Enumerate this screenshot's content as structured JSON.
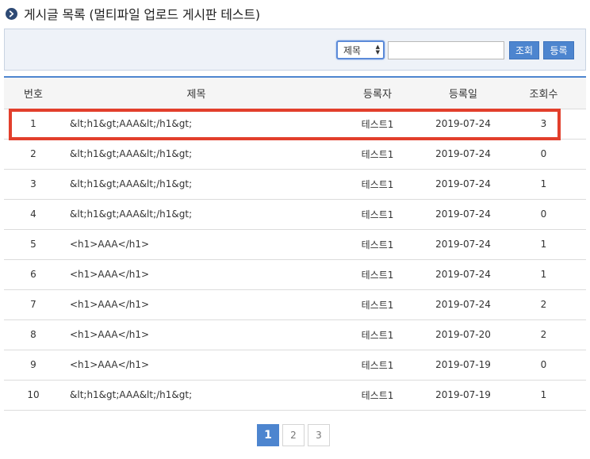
{
  "page": {
    "title": "게시글 목록 (멀티파일 업로드 게시판 테스트)",
    "title_icon": "chevron-right-circle-icon"
  },
  "search": {
    "select_value": "제목",
    "input_value": "",
    "search_button": "조회",
    "register_button": "등록"
  },
  "table": {
    "headers": {
      "num": "번호",
      "title": "제목",
      "author": "등록자",
      "date": "등록일",
      "views": "조회수"
    },
    "rows": [
      {
        "num": "1",
        "title": "&lt;h1&gt;AAA&lt;/h1&gt;",
        "author": "테스트1",
        "date": "2019-07-24",
        "views": "3"
      },
      {
        "num": "2",
        "title": "&lt;h1&gt;AAA&lt;/h1&gt;",
        "author": "테스트1",
        "date": "2019-07-24",
        "views": "0"
      },
      {
        "num": "3",
        "title": "&lt;h1&gt;AAA&lt;/h1&gt;",
        "author": "테스트1",
        "date": "2019-07-24",
        "views": "1"
      },
      {
        "num": "4",
        "title": "&lt;h1&gt;AAA&lt;/h1&gt;",
        "author": "테스트1",
        "date": "2019-07-24",
        "views": "0"
      },
      {
        "num": "5",
        "title": "<h1>AAA</h1>",
        "author": "테스트1",
        "date": "2019-07-24",
        "views": "1"
      },
      {
        "num": "6",
        "title": "<h1>AAA</h1>",
        "author": "테스트1",
        "date": "2019-07-24",
        "views": "1"
      },
      {
        "num": "7",
        "title": "<h1>AAA</h1>",
        "author": "테스트1",
        "date": "2019-07-24",
        "views": "2"
      },
      {
        "num": "8",
        "title": "<h1>AAA</h1>",
        "author": "테스트1",
        "date": "2019-07-20",
        "views": "2"
      },
      {
        "num": "9",
        "title": "<h1>AAA</h1>",
        "author": "테스트1",
        "date": "2019-07-19",
        "views": "0"
      },
      {
        "num": "10",
        "title": "&lt;h1&gt;AAA&lt;/h1&gt;",
        "author": "테스트1",
        "date": "2019-07-19",
        "views": "1"
      }
    ]
  },
  "pagination": {
    "pages": [
      "1",
      "2",
      "3"
    ],
    "current": "1"
  },
  "colors": {
    "accent": "#4d85cf",
    "highlight": "#e23f2c"
  }
}
